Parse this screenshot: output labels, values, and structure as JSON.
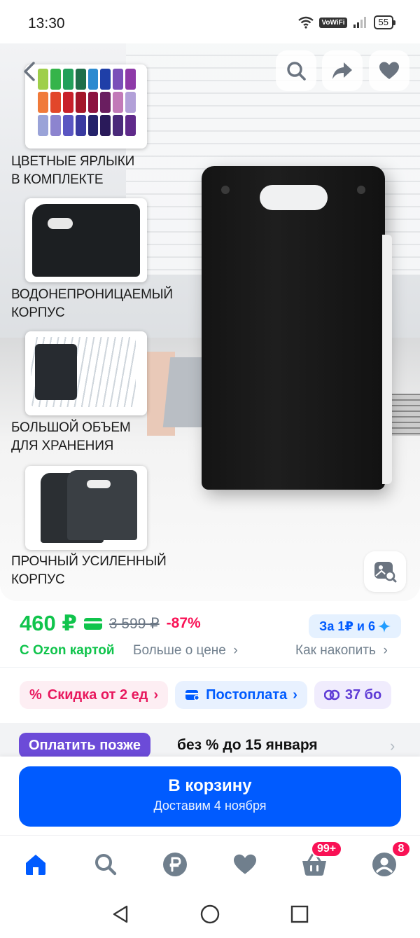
{
  "status_bar": {
    "time": "13:30",
    "network": "VoWiFi",
    "battery": "55"
  },
  "hero": {
    "features": [
      "ЦВЕТНЫЕ ЯРЛЫКИ\nВ КОМПЛЕКТЕ",
      "ВОДОНЕПРОНИЦАЕМЫЙ\nКОРПУС",
      "БОЛЬШОЙ ОБЪЕМ\nДЛЯ ХРАНЕНИЯ",
      "ПРОЧНЫЙ УСИЛЕННЫЙ\nКОРПУС"
    ],
    "swatch_colors": [
      "#9fcf4a",
      "#35b44a",
      "#22a05a",
      "#1f6f4a",
      "#2d8bd0",
      "#1f3fa8",
      "#7a4fb8",
      "#8e3aa8",
      "#f07a3a",
      "#e2462a",
      "#c8202a",
      "#a3162a",
      "#8c1440",
      "#6a1e60",
      "#c27ab8",
      "#b2a0d8",
      "#9aa3d8",
      "#8c84cf",
      "#5a56c2",
      "#3a3aa0",
      "#25236b",
      "#2a1a5a",
      "#4a2a7a",
      "#5f2a8a"
    ]
  },
  "price": {
    "current": "460 ₽",
    "old": "3 599 ₽",
    "discount": "-87%",
    "ozon_card": "С Ozon картой",
    "more_about_price": "Больше о цене",
    "bonus": "За 1₽ и 6",
    "how_to_earn": "Как накопить"
  },
  "chips": [
    {
      "label": "Скидка от 2 ед"
    },
    {
      "label": "Постоплата"
    },
    {
      "label": "37 бо"
    }
  ],
  "pay_later": {
    "label": "Оплатить позже",
    "text": "без % до 15 января"
  },
  "cta": {
    "title": "В корзину",
    "subtitle": "Доставим 4 ноября"
  },
  "tabbar": {
    "cart_badge": "99+",
    "profile_badge": "8"
  },
  "colors": {
    "accent": "#005bff",
    "green": "#10c44c",
    "pink": "#f91155"
  }
}
